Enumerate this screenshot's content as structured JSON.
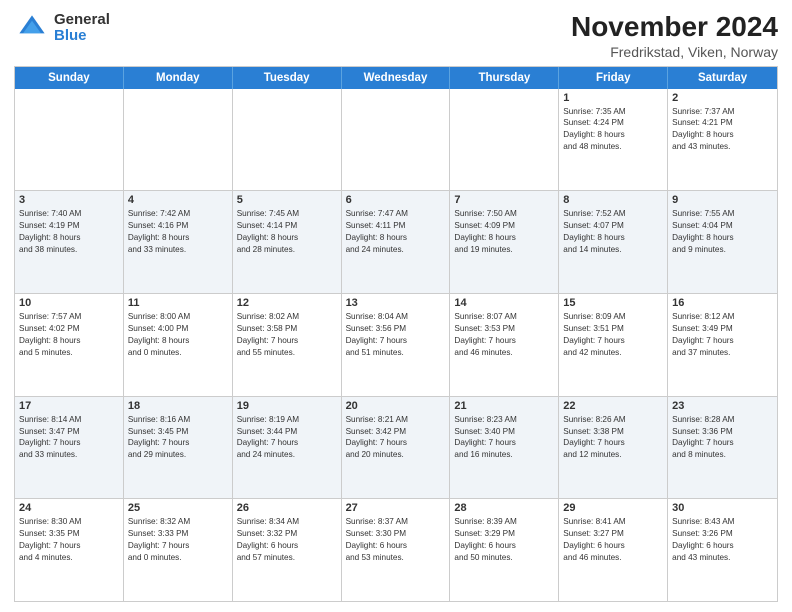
{
  "header": {
    "logo_general": "General",
    "logo_blue": "Blue",
    "title": "November 2024",
    "subtitle": "Fredrikstad, Viken, Norway"
  },
  "days_of_week": [
    "Sunday",
    "Monday",
    "Tuesday",
    "Wednesday",
    "Thursday",
    "Friday",
    "Saturday"
  ],
  "rows": [
    {
      "alt": false,
      "cells": [
        {
          "day": "",
          "info": ""
        },
        {
          "day": "",
          "info": ""
        },
        {
          "day": "",
          "info": ""
        },
        {
          "day": "",
          "info": ""
        },
        {
          "day": "",
          "info": ""
        },
        {
          "day": "1",
          "info": "Sunrise: 7:35 AM\nSunset: 4:24 PM\nDaylight: 8 hours\nand 48 minutes."
        },
        {
          "day": "2",
          "info": "Sunrise: 7:37 AM\nSunset: 4:21 PM\nDaylight: 8 hours\nand 43 minutes."
        }
      ]
    },
    {
      "alt": true,
      "cells": [
        {
          "day": "3",
          "info": "Sunrise: 7:40 AM\nSunset: 4:19 PM\nDaylight: 8 hours\nand 38 minutes."
        },
        {
          "day": "4",
          "info": "Sunrise: 7:42 AM\nSunset: 4:16 PM\nDaylight: 8 hours\nand 33 minutes."
        },
        {
          "day": "5",
          "info": "Sunrise: 7:45 AM\nSunset: 4:14 PM\nDaylight: 8 hours\nand 28 minutes."
        },
        {
          "day": "6",
          "info": "Sunrise: 7:47 AM\nSunset: 4:11 PM\nDaylight: 8 hours\nand 24 minutes."
        },
        {
          "day": "7",
          "info": "Sunrise: 7:50 AM\nSunset: 4:09 PM\nDaylight: 8 hours\nand 19 minutes."
        },
        {
          "day": "8",
          "info": "Sunrise: 7:52 AM\nSunset: 4:07 PM\nDaylight: 8 hours\nand 14 minutes."
        },
        {
          "day": "9",
          "info": "Sunrise: 7:55 AM\nSunset: 4:04 PM\nDaylight: 8 hours\nand 9 minutes."
        }
      ]
    },
    {
      "alt": false,
      "cells": [
        {
          "day": "10",
          "info": "Sunrise: 7:57 AM\nSunset: 4:02 PM\nDaylight: 8 hours\nand 5 minutes."
        },
        {
          "day": "11",
          "info": "Sunrise: 8:00 AM\nSunset: 4:00 PM\nDaylight: 8 hours\nand 0 minutes."
        },
        {
          "day": "12",
          "info": "Sunrise: 8:02 AM\nSunset: 3:58 PM\nDaylight: 7 hours\nand 55 minutes."
        },
        {
          "day": "13",
          "info": "Sunrise: 8:04 AM\nSunset: 3:56 PM\nDaylight: 7 hours\nand 51 minutes."
        },
        {
          "day": "14",
          "info": "Sunrise: 8:07 AM\nSunset: 3:53 PM\nDaylight: 7 hours\nand 46 minutes."
        },
        {
          "day": "15",
          "info": "Sunrise: 8:09 AM\nSunset: 3:51 PM\nDaylight: 7 hours\nand 42 minutes."
        },
        {
          "day": "16",
          "info": "Sunrise: 8:12 AM\nSunset: 3:49 PM\nDaylight: 7 hours\nand 37 minutes."
        }
      ]
    },
    {
      "alt": true,
      "cells": [
        {
          "day": "17",
          "info": "Sunrise: 8:14 AM\nSunset: 3:47 PM\nDaylight: 7 hours\nand 33 minutes."
        },
        {
          "day": "18",
          "info": "Sunrise: 8:16 AM\nSunset: 3:45 PM\nDaylight: 7 hours\nand 29 minutes."
        },
        {
          "day": "19",
          "info": "Sunrise: 8:19 AM\nSunset: 3:44 PM\nDaylight: 7 hours\nand 24 minutes."
        },
        {
          "day": "20",
          "info": "Sunrise: 8:21 AM\nSunset: 3:42 PM\nDaylight: 7 hours\nand 20 minutes."
        },
        {
          "day": "21",
          "info": "Sunrise: 8:23 AM\nSunset: 3:40 PM\nDaylight: 7 hours\nand 16 minutes."
        },
        {
          "day": "22",
          "info": "Sunrise: 8:26 AM\nSunset: 3:38 PM\nDaylight: 7 hours\nand 12 minutes."
        },
        {
          "day": "23",
          "info": "Sunrise: 8:28 AM\nSunset: 3:36 PM\nDaylight: 7 hours\nand 8 minutes."
        }
      ]
    },
    {
      "alt": false,
      "cells": [
        {
          "day": "24",
          "info": "Sunrise: 8:30 AM\nSunset: 3:35 PM\nDaylight: 7 hours\nand 4 minutes."
        },
        {
          "day": "25",
          "info": "Sunrise: 8:32 AM\nSunset: 3:33 PM\nDaylight: 7 hours\nand 0 minutes."
        },
        {
          "day": "26",
          "info": "Sunrise: 8:34 AM\nSunset: 3:32 PM\nDaylight: 6 hours\nand 57 minutes."
        },
        {
          "day": "27",
          "info": "Sunrise: 8:37 AM\nSunset: 3:30 PM\nDaylight: 6 hours\nand 53 minutes."
        },
        {
          "day": "28",
          "info": "Sunrise: 8:39 AM\nSunset: 3:29 PM\nDaylight: 6 hours\nand 50 minutes."
        },
        {
          "day": "29",
          "info": "Sunrise: 8:41 AM\nSunset: 3:27 PM\nDaylight: 6 hours\nand 46 minutes."
        },
        {
          "day": "30",
          "info": "Sunrise: 8:43 AM\nSunset: 3:26 PM\nDaylight: 6 hours\nand 43 minutes."
        }
      ]
    }
  ]
}
